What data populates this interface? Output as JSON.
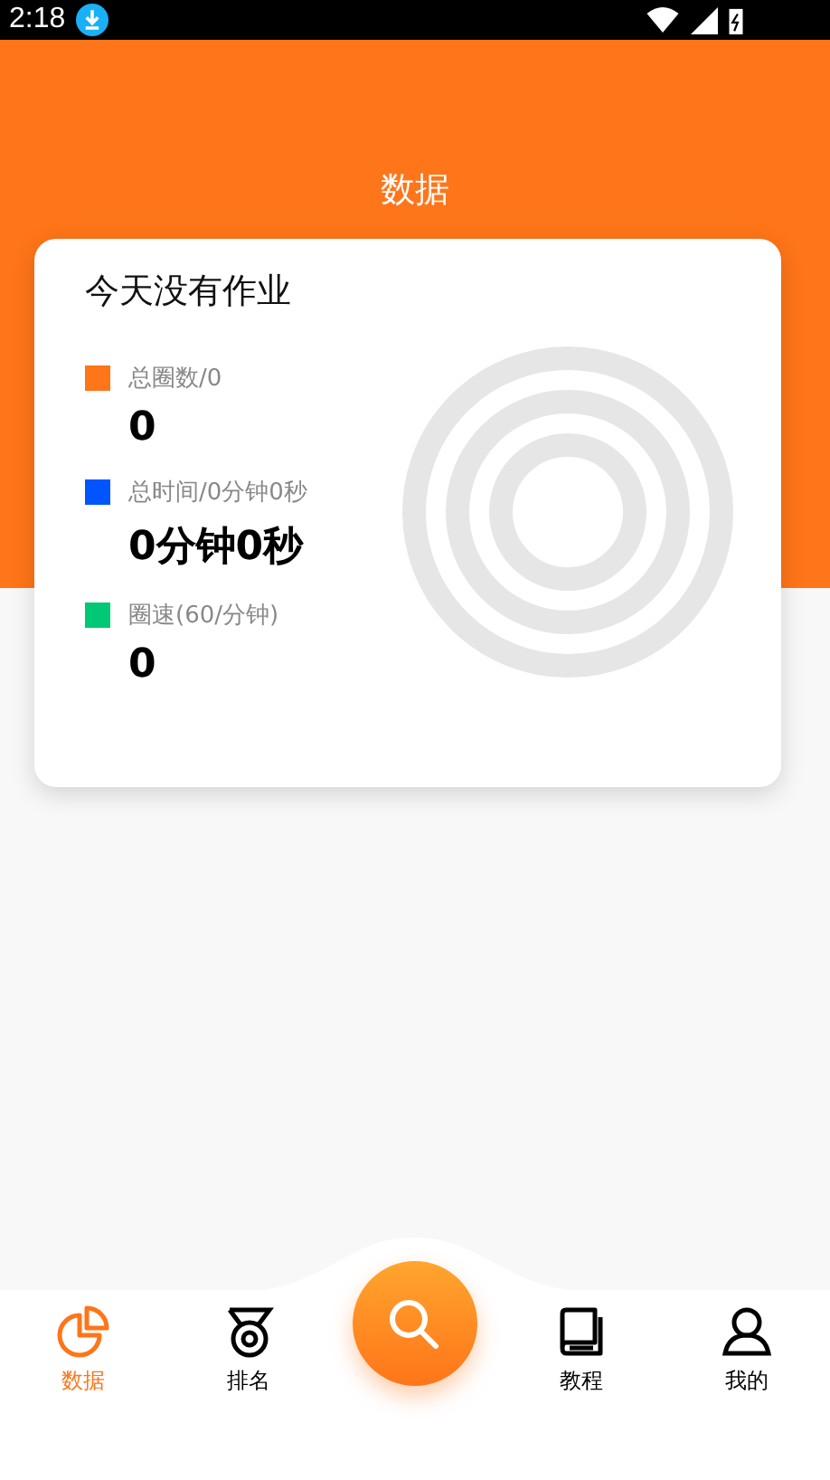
{
  "status_bar": {
    "time": "2:18"
  },
  "header": {
    "title": "数据"
  },
  "card": {
    "title": "今天没有作业",
    "stats": [
      {
        "label": "总圈数/0",
        "value": "0",
        "color": "#ff7519"
      },
      {
        "label": "总时间/0分钟0秒",
        "value": "0分钟0秒",
        "color": "#0055ff"
      },
      {
        "label": "圈速(60/分钟)",
        "value": "0",
        "color": "#00c875"
      }
    ]
  },
  "nav": [
    {
      "kind": "chart",
      "label": "数据",
      "selected": true
    },
    {
      "kind": "medal",
      "label": "排名",
      "selected": false
    },
    {
      "kind": "search"
    },
    {
      "kind": "book",
      "label": "教程",
      "selected": false
    },
    {
      "kind": "user",
      "label": "我的",
      "selected": false
    }
  ]
}
